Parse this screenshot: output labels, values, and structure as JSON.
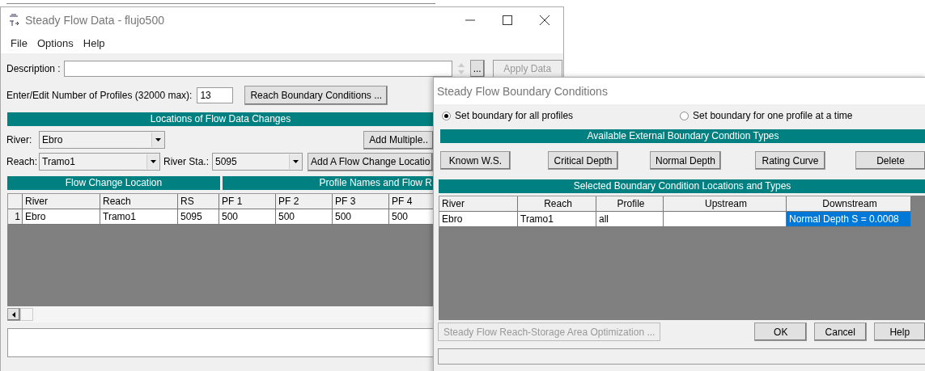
{
  "main_window": {
    "title": "Steady Flow Data - flujo500",
    "menu": [
      "File",
      "Options",
      "Help"
    ],
    "description": {
      "label": "Description :"
    },
    "more_button": "...",
    "apply_button": {
      "label": "Apply Data",
      "disabled": true
    },
    "profiles": {
      "label": "Enter/Edit Number of Profiles (32000 max):",
      "value": "13"
    },
    "reach_button": "Reach Boundary Conditions ...",
    "locations_header": "Locations of Flow Data Changes",
    "river": {
      "label": "River:",
      "value": "Ebro"
    },
    "add_multiple": "Add Multiple..",
    "reach": {
      "label": "Reach:",
      "value": "Tramo1"
    },
    "river_sta": {
      "label": "River Sta.:",
      "value": "5095"
    },
    "add_location": "Add A Flow Change Locatio",
    "group_headers": [
      "Flow Change Location",
      "Profile Names and Flow R"
    ],
    "table": {
      "columns": [
        "River",
        "Reach",
        "RS",
        "PF 1",
        "PF 2",
        "PF 3",
        "PF 4"
      ],
      "rows": [
        {
          "number": "1",
          "cells": [
            "Ebro",
            "Tramo1",
            "5095",
            "500",
            "500",
            "500",
            "500"
          ]
        }
      ]
    }
  },
  "dialog": {
    "title": "Steady Flow Boundary Conditions",
    "radios": [
      {
        "label": "Set boundary for all profiles",
        "selected": true
      },
      {
        "label": "Set boundary for one profile at a time",
        "selected": false
      }
    ],
    "types_header": "Available External Boundary Condtion Types",
    "type_buttons": [
      "Known W.S.",
      "Critical Depth",
      "Normal Depth",
      "Rating Curve",
      "Delete"
    ],
    "locations_header": "Selected Boundary Condition Locations and Types",
    "table": {
      "columns": [
        "River",
        "Reach",
        "Profile",
        "Upstream",
        "Downstream"
      ],
      "rows": [
        {
          "cells": [
            {
              "text": "Ebro",
              "selected": false
            },
            {
              "text": "Tramo1",
              "selected": false
            },
            {
              "text": "all",
              "selected": false
            },
            {
              "selected": false
            },
            {
              "text": "Normal Depth S = 0.0008",
              "selected": true
            }
          ]
        }
      ]
    },
    "optimize_button": {
      "label": "Steady Flow Reach-Storage Area Optimization ...",
      "disabled": true
    },
    "buttons": [
      "OK",
      "Cancel",
      "Help"
    ]
  }
}
